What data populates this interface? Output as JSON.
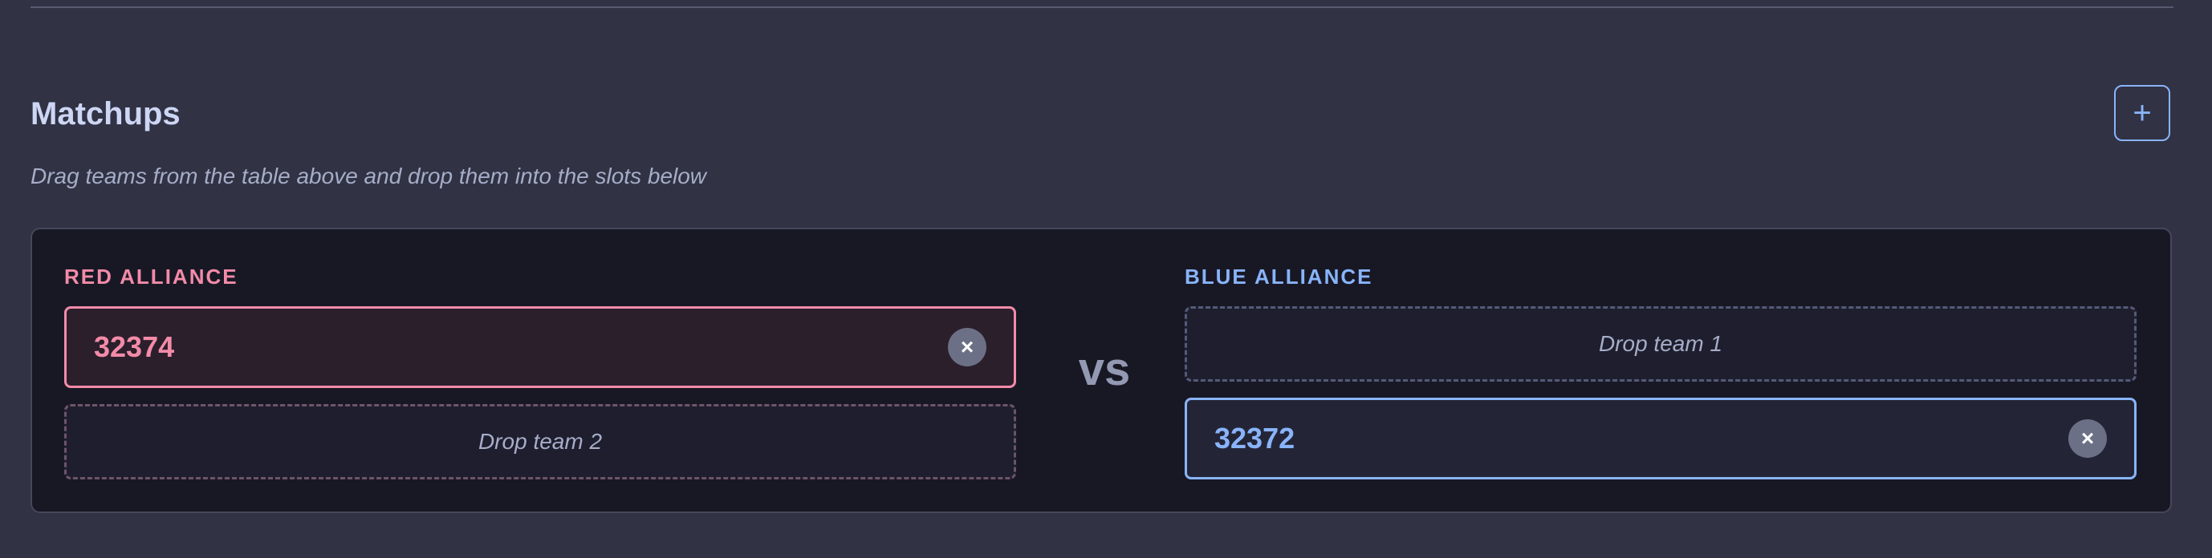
{
  "section": {
    "title": "Matchups",
    "add_label": "+",
    "subtitle": "Drag teams from the table above and drop them into the slots below"
  },
  "matchup": {
    "vs_label": "vs",
    "red": {
      "label": "RED ALLIANCE",
      "slots": [
        {
          "team": "32374",
          "remove_glyph": "×"
        },
        {
          "placeholder": "Drop team 2"
        }
      ]
    },
    "blue": {
      "label": "BLUE ALLIANCE",
      "slots": [
        {
          "placeholder": "Drop team 1"
        },
        {
          "team": "32372",
          "remove_glyph": "×"
        }
      ]
    }
  },
  "icons": {
    "add": "plus-icon",
    "remove": "close-icon"
  },
  "colors": {
    "background": "#313244",
    "card": "#181825",
    "red_accent": "#f38ba8",
    "blue_accent": "#89b4fa",
    "muted": "#a6adc8"
  }
}
